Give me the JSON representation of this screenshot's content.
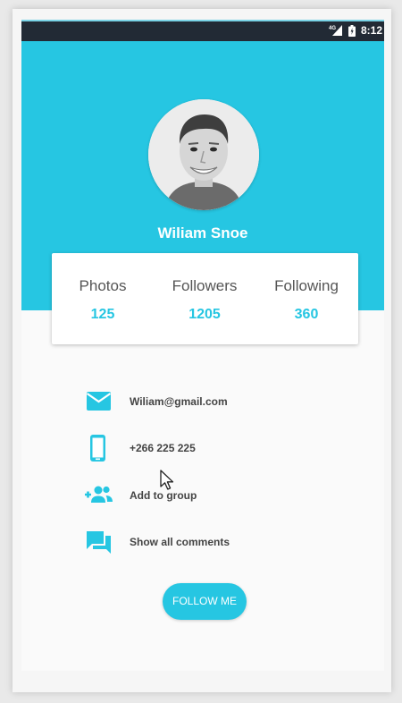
{
  "status_bar": {
    "time": "8:12",
    "network": "4G"
  },
  "profile": {
    "name": "Wiliam Snoe",
    "avatar_icon": "user-photo"
  },
  "stats": [
    {
      "label": "Photos",
      "value": "125"
    },
    {
      "label": "Followers",
      "value": "1205"
    },
    {
      "label": "Following",
      "value": "360"
    }
  ],
  "details": {
    "email": "Wiliam@gmail.com",
    "phone": "+266 225 225",
    "add_to_group": "Add to group",
    "show_comments": "Show all comments"
  },
  "icons": {
    "email": "email-icon",
    "phone": "phone-icon",
    "group": "group-add-icon",
    "comments": "comments-icon"
  },
  "actions": {
    "follow_label": "FOLLOW ME"
  },
  "colors": {
    "accent": "#26c6e2",
    "status_bar": "#222a35",
    "background": "#fafafa"
  }
}
